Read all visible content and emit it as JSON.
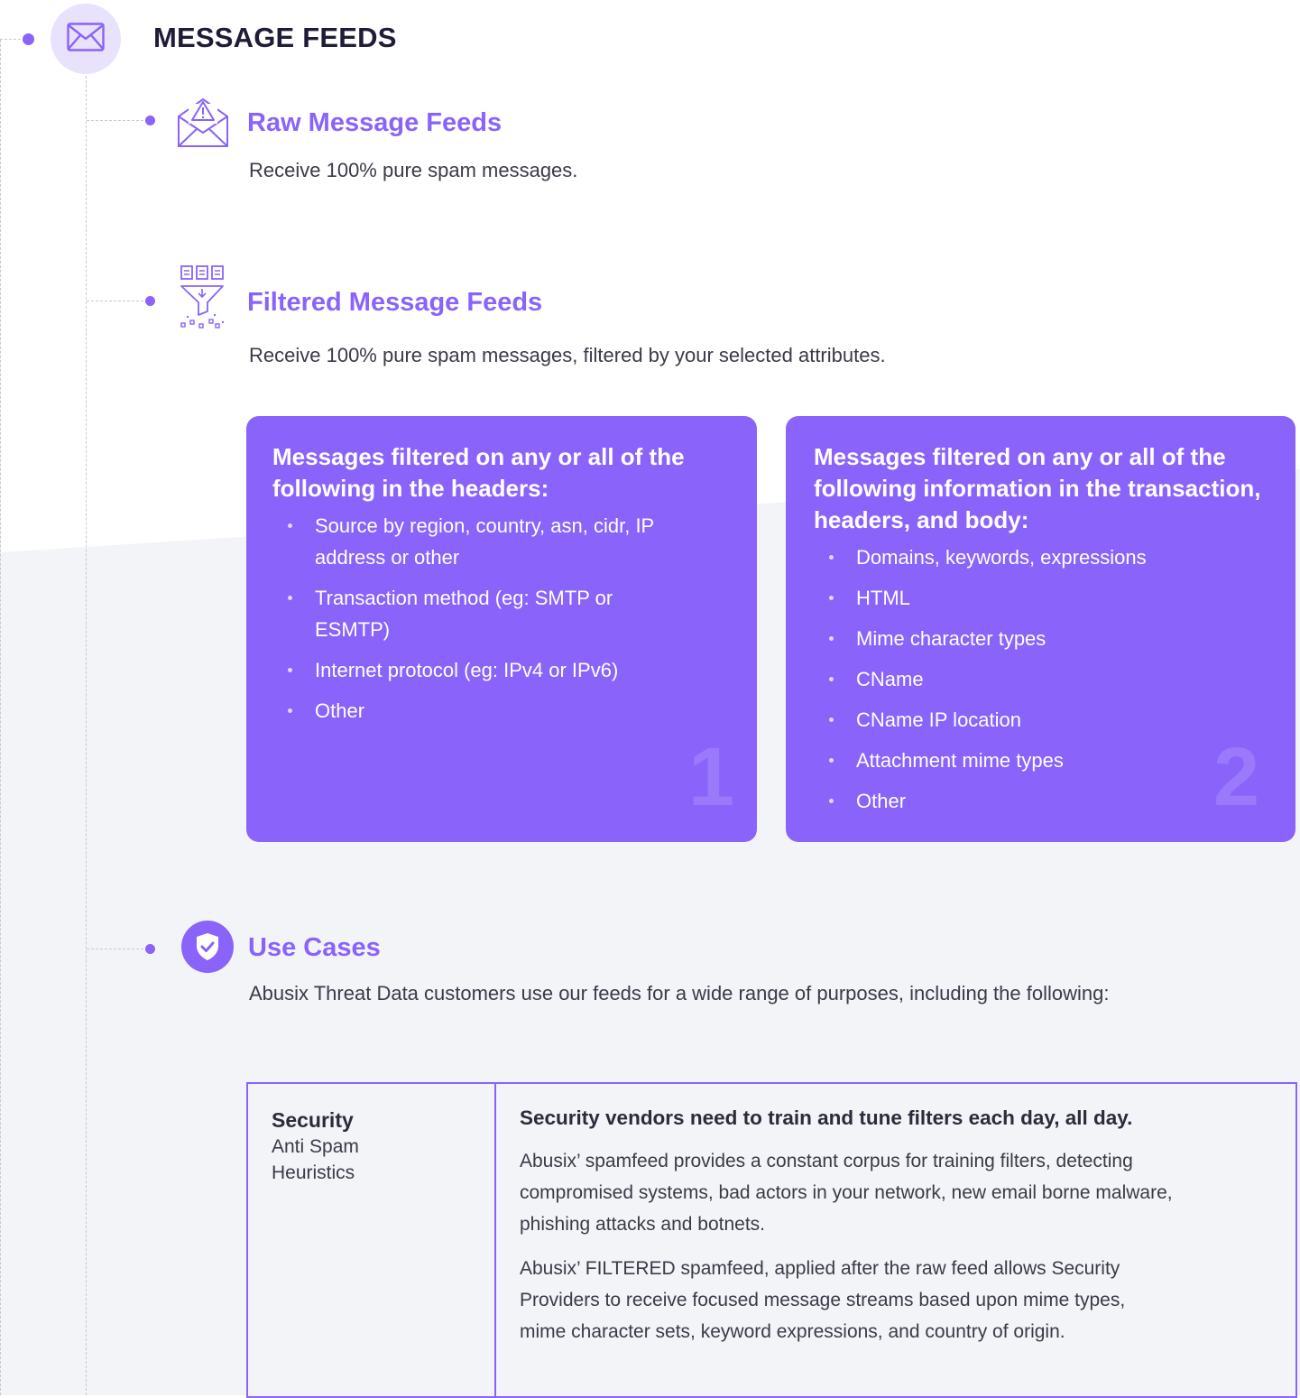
{
  "section": {
    "title": "MESSAGE FEEDS"
  },
  "raw_feeds": {
    "title": "Raw Message Feeds",
    "description": "Receive 100% pure spam messages."
  },
  "filtered_feeds": {
    "title": "Filtered Message Feeds",
    "description": "Receive 100% pure spam messages, filtered by your selected attributes."
  },
  "cards": [
    {
      "title": "Messages filtered on any or all of the following in the headers:",
      "items": [
        "Source by region, country, asn, cidr, IP address or other",
        "Transaction method (eg: SMTP or ESMTP)",
        "Internet protocol (eg: IPv4 or IPv6)",
        "Other"
      ],
      "number": "1"
    },
    {
      "title": "Messages filtered on any or all of the following information in the transaction, headers, and body:",
      "items": [
        "Domains, keywords, expressions",
        "HTML",
        "Mime character types",
        "CName",
        "CName IP location",
        "Attachment mime types",
        "Other"
      ],
      "number": "2"
    }
  ],
  "use_cases": {
    "title": "Use Cases",
    "description": "Abusix Threat Data customers use our feeds for a wide range of purposes, including the following:",
    "table": {
      "category": "Security",
      "subcategories": [
        "Anti Spam",
        "Heuristics"
      ],
      "heading": "Security vendors need to train and tune filters each day, all day.",
      "paragraphs": [
        "Abusix’ spamfeed provides a constant corpus for training filters, detecting compromised systems, bad actors in your network, new email borne malware, phishing attacks and botnets.",
        "Abusix’ FILTERED spamfeed, applied after the raw feed allows Security Providers to receive focused message streams based upon mime types,      mime character sets, keyword expressions, and country of origin."
      ]
    }
  },
  "colors": {
    "accent": "#8a63fb",
    "accent_light": "#e9e2fd",
    "heading_dark": "#1f1c3a",
    "band": "#f3f4f8",
    "connector": "#c6c8d4"
  },
  "icons": {
    "main": "envelope-icon",
    "raw": "envelope-warning-icon",
    "filtered": "funnel-filter-icon",
    "use_cases": "shield-check-icon"
  }
}
